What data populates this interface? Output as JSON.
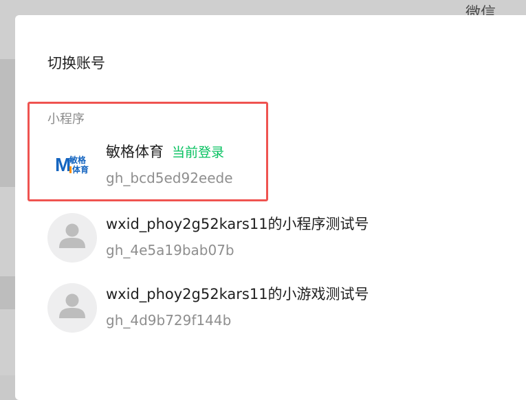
{
  "background": {
    "partial_text": "微信",
    "overlay_color": "#cfcfcf"
  },
  "dialog": {
    "title": "切换账号",
    "section_label": "小程序",
    "accounts": [
      {
        "name": "敏格体育",
        "current_tag": "当前登录",
        "id": "gh_bcd5ed92eede",
        "avatar": "brand-logo",
        "logo_text_top": "敏格",
        "logo_text_bottom": "体育",
        "logo_letter": "M"
      },
      {
        "name": "wxid_phoy2g52kars11的小程序测试号",
        "id": "gh_4e5a19bab07b",
        "avatar": "user-placeholder-icon"
      },
      {
        "name": "wxid_phoy2g52kars11的小游戏测试号",
        "id": "gh_4d9b729f144b",
        "avatar": "user-placeholder-icon"
      }
    ]
  },
  "colors": {
    "accent_green": "#07c160",
    "highlight_red": "#ef5350",
    "logo_blue": "#1565c0"
  }
}
